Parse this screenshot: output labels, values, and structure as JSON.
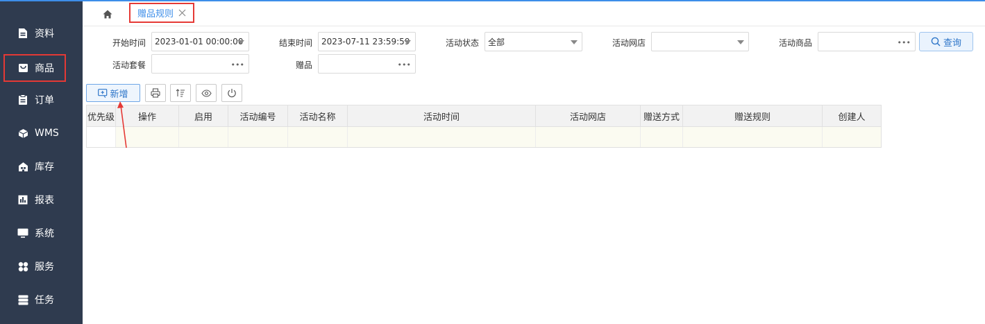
{
  "sidebar": {
    "items": [
      {
        "label": "资料",
        "icon": "file-icon"
      },
      {
        "label": "商品",
        "icon": "shopping-bag-icon"
      },
      {
        "label": "订单",
        "icon": "clipboard-icon"
      },
      {
        "label": "WMS",
        "icon": "cube-icon"
      },
      {
        "label": "库存",
        "icon": "warehouse-icon"
      },
      {
        "label": "报表",
        "icon": "bar-chart-icon"
      },
      {
        "label": "系统",
        "icon": "monitor-icon"
      },
      {
        "label": "服务",
        "icon": "apps-icon"
      },
      {
        "label": "任务",
        "icon": "server-icon"
      }
    ]
  },
  "tabs": {
    "active_label": "赠品规则"
  },
  "filters": {
    "start_time_label": "开始时间",
    "start_time_value": "2023-01-01 00:00:00",
    "end_time_label": "结束时间",
    "end_time_value": "2023-07-11 23:59:59",
    "status_label": "活动状态",
    "status_value": "全部",
    "shop_label": "活动网店",
    "shop_value": "",
    "product_label": "活动商品",
    "product_value": "",
    "package_label": "活动套餐",
    "package_value": "",
    "gift_label": "赠品",
    "gift_value": "",
    "query_label": "查询"
  },
  "toolbar": {
    "add_label": "新增"
  },
  "table": {
    "columns": [
      "优先级",
      "操作",
      "启用",
      "活动编号",
      "活动名称",
      "活动时间",
      "活动网店",
      "赠送方式",
      "赠送规则",
      "创建人"
    ]
  },
  "colors": {
    "sidebar_bg": "#2f3b4f",
    "accent": "#3d8ee9",
    "highlight": "#e53935"
  }
}
